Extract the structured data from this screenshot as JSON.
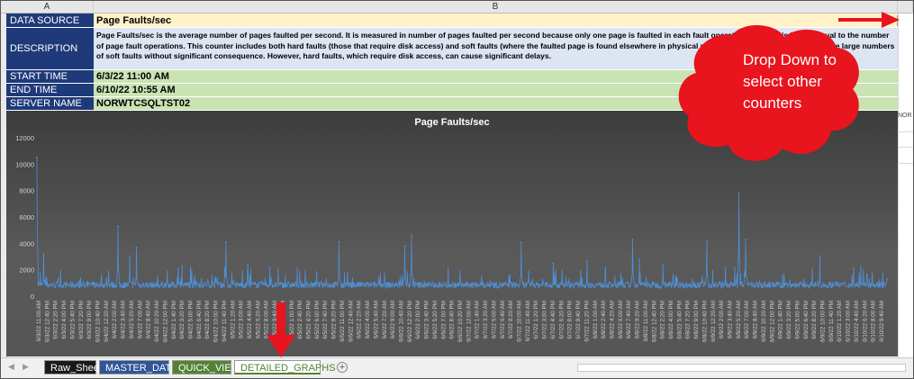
{
  "columns": {
    "a": "A",
    "b": "B"
  },
  "rows": {
    "data_source": {
      "label": "DATA SOURCE",
      "value": "Page Faults/sec"
    },
    "description": {
      "label": "DESCRIPTION",
      "value": "Page Faults/sec is the average number of pages faulted per second. It is measured in number of pages faulted per second because only one page is faulted in each fault operation, hence this is also equal to the number of page fault operations. This counter includes both hard faults (those that require disk access) and soft faults (where the faulted page is found elsewhere in physical memory.) Most processors can handle large numbers of soft faults without significant consequence. However, hard faults, which require disk access, can cause significant delays."
    },
    "start_time": {
      "label": "START TIME",
      "value": "6/3/22 11:00 AM"
    },
    "end_time": {
      "label": "END TIME",
      "value": "6/10/22 10:55 AM"
    },
    "server_name": {
      "label": "SERVER NAME",
      "value": "NORWTCSQLTST02"
    }
  },
  "clipped_text": "NOR",
  "dropdown_icon": "chevron-down-icon",
  "callout": {
    "text": "Drop Down to select other counters",
    "color": "#e8141e"
  },
  "chart_data": {
    "type": "line",
    "title": "Page Faults/sec",
    "ylim": [
      0,
      12000
    ],
    "yticks": [
      0,
      2000,
      4000,
      6000,
      8000,
      10000,
      12000
    ],
    "grid": false,
    "series_color": "#4d90d8",
    "peaks": [
      {
        "x": "6/3/22 11:00 AM",
        "y": 10500
      },
      {
        "x": "6/3/22 12:20 PM",
        "y": 3200
      },
      {
        "x": "6/4/22 3:00 AM",
        "y": 5300
      },
      {
        "x": "6/4/22 5:20 AM",
        "y": 3000
      },
      {
        "x": "6/4/22 6:40 AM",
        "y": 3700
      },
      {
        "x": "6/4/22 3:40 PM",
        "y": 2300
      },
      {
        "x": "6/5/22 12:20 AM",
        "y": 4100
      },
      {
        "x": "6/5/22 4:40 AM",
        "y": 2400
      },
      {
        "x": "6/5/22 9:00 AM",
        "y": 2200
      },
      {
        "x": "6/5/22 10:40 PM",
        "y": 4100
      },
      {
        "x": "6/6/22 11:40 AM",
        "y": 3800
      },
      {
        "x": "6/6/22 1:00 PM",
        "y": 4600
      },
      {
        "x": "6/7/22 10:40 AM",
        "y": 4100
      },
      {
        "x": "6/7/22 5:00 PM",
        "y": 2500
      },
      {
        "x": "6/7/22 11:40 PM",
        "y": 2700
      },
      {
        "x": "6/8/22 8:40 AM",
        "y": 4300
      },
      {
        "x": "6/8/22 10:00 AM",
        "y": 2800
      },
      {
        "x": "6/8/22 2:40 PM",
        "y": 2400
      },
      {
        "x": "6/8/22 11:20 PM",
        "y": 4200
      },
      {
        "x": "6/9/22 3:00 AM",
        "y": 2100
      },
      {
        "x": "6/9/22 5:40 AM",
        "y": 7800
      },
      {
        "x": "6/9/22 7:00 AM",
        "y": 4300
      },
      {
        "x": "6/9/22 9:40 PM",
        "y": 3000
      },
      {
        "x": "6/10/22 4:20 AM",
        "y": 2100
      },
      {
        "x": "6/10/22 7:00 AM",
        "y": 1600
      },
      {
        "x": "6/10/22 10:55 AM",
        "y": 1300
      }
    ],
    "baseline": 600,
    "x_tick_labels": [
      "6/3/22 11:00 AM",
      "6/3/22 12:40 PM",
      "6/3/22 2:20 PM",
      "6/3/22 4:00 PM",
      "6/3/22 5:40 PM",
      "6/3/22 7:20 PM",
      "6/3/22 9:00 PM",
      "6/3/22 10:40 PM",
      "6/4/22 12:20 AM",
      "6/4/22 2:00 AM",
      "6/4/22 3:40 AM",
      "6/4/22 5:20 AM",
      "6/4/22 7:00 AM",
      "6/4/22 8:40 AM",
      "6/4/22 10:20 AM",
      "6/4/22 12:00 PM",
      "6/4/22 1:40 PM",
      "6/4/22 3:20 PM",
      "6/4/22 5:00 PM",
      "6/4/22 6:40 PM",
      "6/4/22 8:20 PM",
      "6/4/22 10:00 PM",
      "6/4/22 11:40 PM",
      "6/5/22 1:20 AM",
      "6/5/22 3:00 AM",
      "6/5/22 4:40 AM",
      "6/5/22 6:20 AM",
      "6/5/22 8:00 AM",
      "6/5/22 9:40 AM",
      "6/5/22 11:20 AM",
      "6/5/22 1:00 PM",
      "6/5/22 2:40 PM",
      "6/5/22 4:20 PM",
      "6/5/22 6:00 PM",
      "6/5/22 7:40 PM",
      "6/5/22 9:20 PM",
      "6/5/22 11:00 PM",
      "6/6/22 12:40 AM",
      "6/6/22 2:20 AM",
      "6/6/22 4:00 AM",
      "6/6/22 5:40 AM",
      "6/6/22 7:20 AM",
      "6/6/22 9:00 AM",
      "6/6/22 10:40 AM",
      "6/6/22 12:20 PM",
      "6/6/22 2:00 PM",
      "6/6/22 3:40 PM",
      "6/6/22 5:20 PM",
      "6/6/22 7:00 PM",
      "6/6/22 8:40 PM",
      "6/6/22 10:20 PM",
      "6/7/22 12:00 AM",
      "6/7/22 1:40 AM",
      "6/7/22 3:20 AM",
      "6/7/22 5:00 AM",
      "6/7/22 6:40 AM",
      "6/7/22 8:20 AM",
      "6/7/22 10:00 AM",
      "6/7/22 11:40 AM",
      "6/7/22 1:20 PM",
      "6/7/22 3:00 PM",
      "6/7/22 4:40 PM",
      "6/7/22 6:20 PM",
      "6/7/22 8:00 PM",
      "6/7/22 9:40 PM",
      "6/7/22 11:20 PM",
      "6/8/22 1:00 AM",
      "6/8/22 2:40 AM",
      "6/8/22 4:20 AM",
      "6/8/22 6:00 AM",
      "6/8/22 7:40 AM",
      "6/8/22 9:20 AM",
      "6/8/22 11:00 AM",
      "6/8/22 12:40 PM",
      "6/8/22 2:20 PM",
      "6/8/22 4:00 PM",
      "6/8/22 5:40 PM",
      "6/8/22 7:20 PM",
      "6/8/22 9:00 PM",
      "6/8/22 10:40 PM",
      "6/9/22 12:20 AM",
      "6/9/22 2:00 AM",
      "6/9/22 3:40 AM",
      "6/9/22 5:20 AM",
      "6/9/22 7:00 AM",
      "6/9/22 8:40 AM",
      "6/9/22 10:20 AM",
      "6/9/22 12:00 PM",
      "6/9/22 1:40 PM",
      "6/9/22 3:20 PM",
      "6/9/22 5:00 PM",
      "6/9/22 6:40 PM",
      "6/9/22 8:20 PM",
      "6/9/22 10:00 PM",
      "6/9/22 11:40 PM",
      "6/10/22 1:20 AM",
      "6/10/22 3:00 AM",
      "6/10/22 4:40 AM",
      "6/10/22 6:20 AM",
      "6/10/22 8:00 AM",
      "6/10/22 9:40 AM"
    ]
  },
  "sheets": [
    {
      "name": "Raw_Sheet",
      "bg": "#1a1a1a",
      "fg": "#ffffff"
    },
    {
      "name": "MASTER_DATA",
      "bg": "#2f5597",
      "fg": "#ffffff"
    },
    {
      "name": "QUICK_VIEW",
      "bg": "#548235",
      "fg": "#ffffff"
    },
    {
      "name": "DETAILED_GRAPHS",
      "bg": "#ffffff",
      "fg": "#548235",
      "active": true
    }
  ],
  "add_sheet": "+",
  "arrow_color": "#e8141e"
}
